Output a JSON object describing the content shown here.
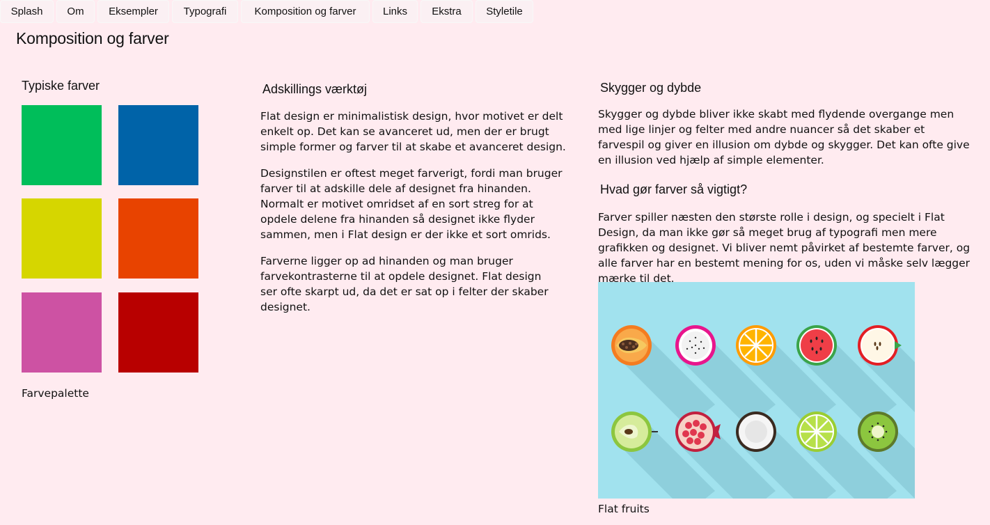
{
  "nav": [
    "Splash",
    "Om",
    "Eksempler",
    "Typografi",
    "Komposition og farver",
    "Links",
    "Ekstra",
    "Styletile"
  ],
  "page_title": "Komposition og farver",
  "colors_section": {
    "heading": "Typiske farver",
    "swatches": [
      "#00be5a",
      "#0063a8",
      "#d6d600",
      "#e84300",
      "#cd52a3",
      "#b80000"
    ],
    "caption": "Farvepalette"
  },
  "middle": {
    "heading": "Adskillings værktøj",
    "paragraphs": [
      "Flat design er minimalistisk design, hvor motivet er delt enkelt op. Det kan se avanceret ud, men der er brugt simple former og farver til at skabe et avanceret design.",
      "Designstilen er oftest meget farverigt, fordi man bruger farver til at adskille dele af designet fra hinanden. Normalt er motivet omridset af en sort streg for at opdele delene fra hinanden så designet ikke flyder sammen, men i Flat design er der ikke et sort omrids.",
      "Farverne ligger op ad hinanden og man bruger farvekontrasterne til at opdele designet. Flat design ser ofte skarpt ud, da det er sat op i felter der skaber designet."
    ]
  },
  "right": {
    "heading1": "Skygger og dybde",
    "para1": "Skygger og dybde bliver ikke skabt med flydende overgange men med lige linjer og felter med andre nuancer så det skaber et farvespil og giver en illusion om dybde og skygger. Det kan ofte give en illusion ved hjælp af simple elementer.",
    "heading2": "Hvad gør farver så vigtigt?",
    "para2": "Farver spiller næsten den største rolle i design, og specielt i Flat Design, da man ikke gør så meget brug af typografi men mere grafikken og designet. Vi bliver nemt påvirket af bestemte farver, og alle farver har en bestemt mening for os, uden vi måske selv lægger mærke til det.",
    "image_caption": "Flat fruits",
    "image_bg": "#a1e2ee"
  }
}
